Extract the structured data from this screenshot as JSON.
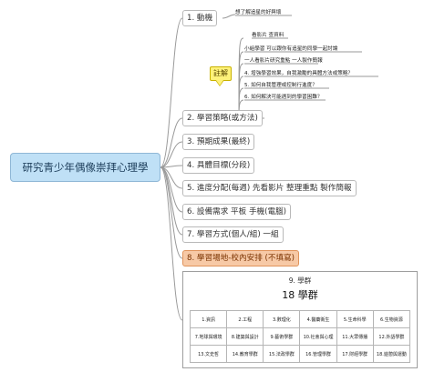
{
  "root": {
    "label": "研究青少年偶像崇拜心理學"
  },
  "branches": [
    {
      "label": "1. 動機"
    },
    {
      "label": "2. 學習策略(或方法)"
    },
    {
      "label": "3. 預期成果(最終)"
    },
    {
      "label": "4. 具體目標(分段)"
    },
    {
      "label": "5. 進度分配(每週) 先看影片 整理重點 製作簡報"
    },
    {
      "label": "6. 設備需求 平板 手機(電腦)"
    },
    {
      "label": "7. 學習方式(個人/組) 一組"
    },
    {
      "label": "8. 學習場地-校內安排 (不填寫)"
    }
  ],
  "motive_note": "想了解追星的好與壞",
  "callout": {
    "label": "註解"
  },
  "strategy_notes": [
    "看影片 查資料",
    "小組學習 可以跟你有追星的同學一起討論",
    "一人看影片研究重點 一人製作簡報",
    "4. 增強學習效果，自我激勵的具體方法或策略？",
    "5. 如何自我管理或控制行進度？",
    "6. 如何解決可能遇到的學習困難？"
  ],
  "groups_card": {
    "title": "9. 學群",
    "heading": "18 學群",
    "rows": [
      [
        "1.資訊",
        "2.工程",
        "3.數理化",
        "4.醫藥衛生",
        "5.生命科學",
        "6.生物資源"
      ],
      [
        "7.地球與環境",
        "8.建築與設計",
        "9.藝術學群",
        "10.社會與心理",
        "11.大眾傳播",
        "12.外語學群"
      ],
      [
        "13.文史哲",
        "14.教育學群",
        "15.法政學群",
        "16.管理學群",
        "17.財經學群",
        "18.遊憩與運動"
      ]
    ]
  },
  "colors": {
    "root_fill": "#bfe0f6",
    "highlight_fill": "#f7c9a6",
    "callout_fill": "#fff27a",
    "connector": "#9a9a9a"
  }
}
